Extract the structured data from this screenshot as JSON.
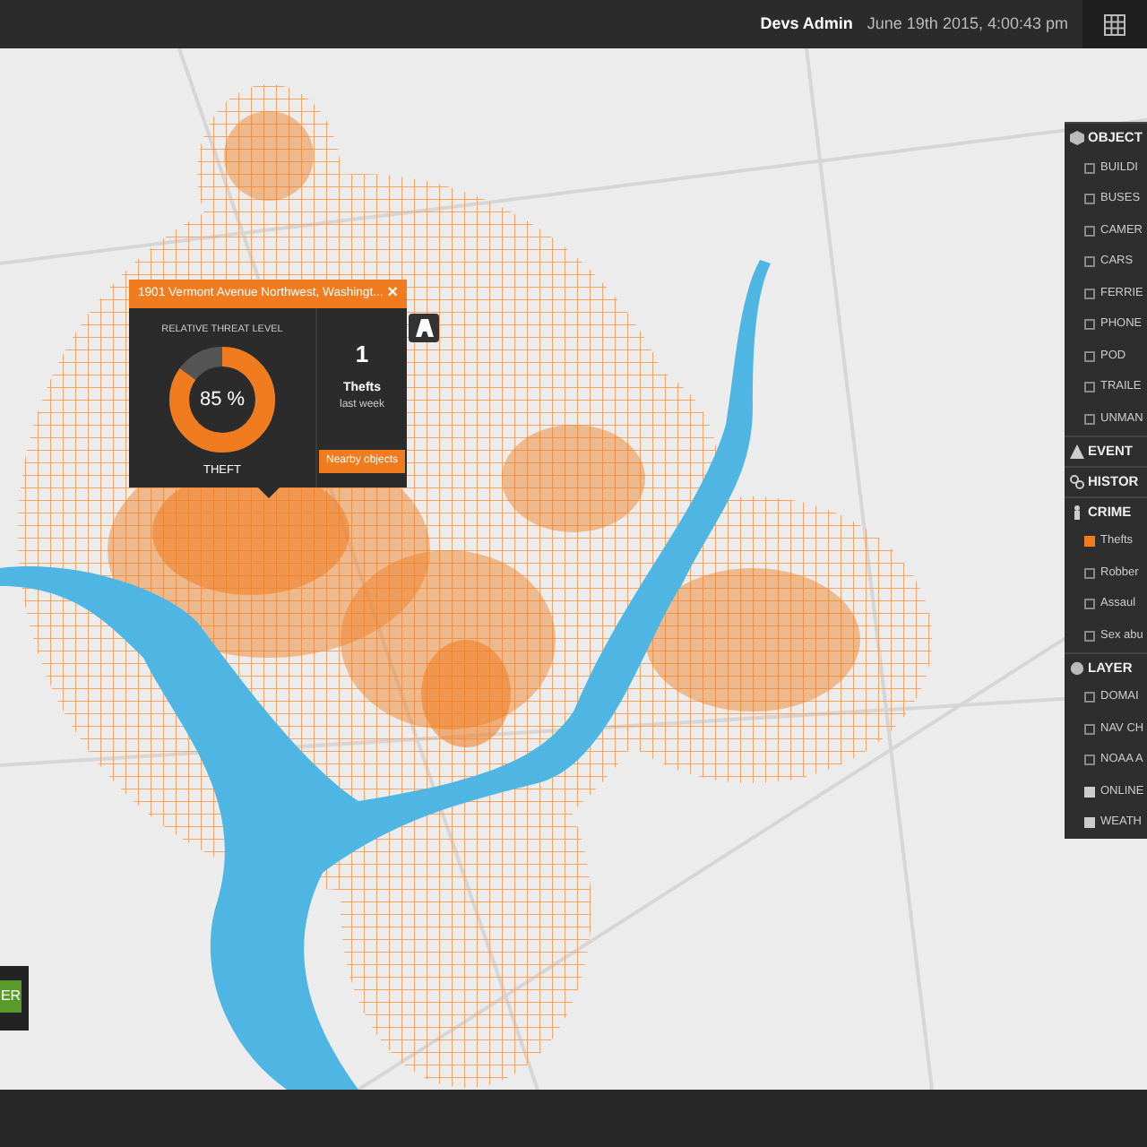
{
  "header": {
    "user": "Devs Admin",
    "datetime": "June 19th 2015, 4:00:43 pm"
  },
  "popup": {
    "address": "1901 Vermont Avenue Northwest, Washingt...",
    "close": "×",
    "threat_label": "RELATIVE THREAT LEVEL",
    "level": 0.85,
    "percent": "85 %",
    "category": "THEFT",
    "count": "1",
    "count_label": "Thefts",
    "period": "last week",
    "button": "Nearby objects"
  },
  "side_panel": {
    "sections": [
      {
        "title": "OBJECT",
        "items": [
          {
            "label": "BUILDI",
            "checked": false
          },
          {
            "label": "BUSES",
            "checked": false
          },
          {
            "label": "CAMER",
            "checked": false
          },
          {
            "label": "CARS",
            "checked": false
          },
          {
            "label": "FERRIE",
            "checked": false
          },
          {
            "label": "PHONE",
            "checked": false
          },
          {
            "label": "POD",
            "checked": false
          },
          {
            "label": "TRAILE",
            "checked": false
          },
          {
            "label": "UNMAN",
            "checked": false
          }
        ]
      },
      {
        "title": "EVENT"
      },
      {
        "title": "HISTOR"
      },
      {
        "title": "CRIME",
        "items": [
          {
            "label": "Thefts",
            "checked": true,
            "color": "#f07c1f"
          },
          {
            "label": "Robber",
            "checked": false
          },
          {
            "label": "Assaul",
            "checked": false
          },
          {
            "label": "Sex abu",
            "checked": false
          }
        ]
      },
      {
        "title": "LAYER",
        "items": [
          {
            "label": "DOMAI",
            "checked": false
          },
          {
            "label": "NAV CH",
            "checked": false
          },
          {
            "label": "NOAA A",
            "checked": false
          },
          {
            "label": "ONLINE",
            "checked": true,
            "color": "#cccccc"
          },
          {
            "label": "WEATH",
            "checked": true,
            "color": "#cccccc"
          }
        ]
      }
    ]
  },
  "left_button": {
    "label": "ER"
  }
}
